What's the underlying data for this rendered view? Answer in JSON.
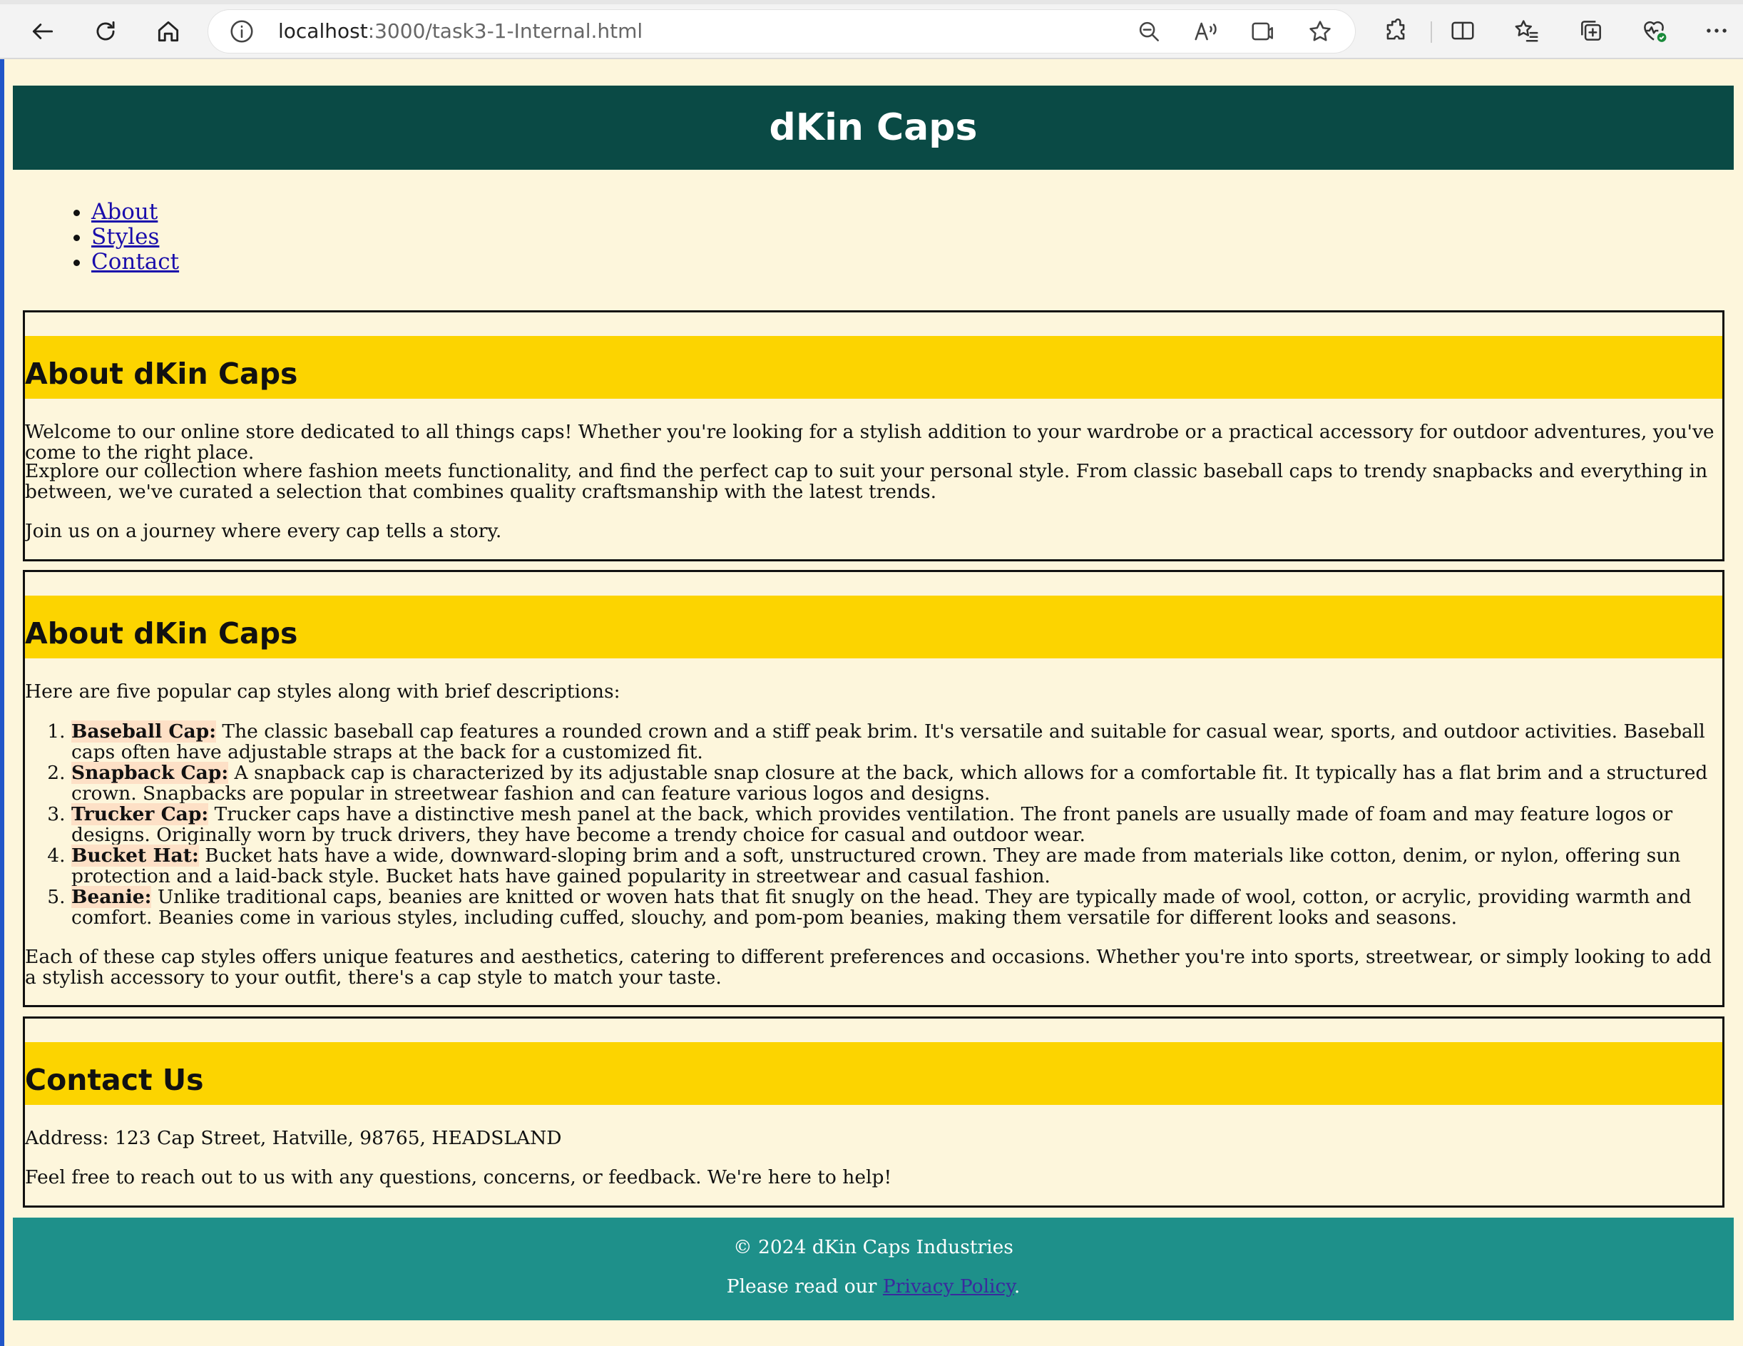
{
  "browser": {
    "url_host": "localhost",
    "url_path": ":3000/task3-1-Internal.html"
  },
  "header": {
    "title": "dKin Caps"
  },
  "nav": {
    "items": [
      "About",
      "Styles",
      "Contact"
    ]
  },
  "about": {
    "heading": "About dKin Caps",
    "p1": "Welcome to our online store dedicated to all things caps! Whether you're looking for a stylish addition to your wardrobe or a practical accessory for outdoor adventures, you've come to the right place.",
    "p2": "Explore our collection where fashion meets functionality, and find the perfect cap to suit your personal style. From classic baseball caps to trendy snapbacks and everything in between, we've curated a selection that combines quality craftsmanship with the latest trends.",
    "p3": "Join us on a journey where every cap tells a story."
  },
  "styles": {
    "heading": "About dKin Caps",
    "intro": "Here are five popular cap styles along with brief descriptions:",
    "items": [
      {
        "name": "Baseball Cap:",
        "desc": " The classic baseball cap features a rounded crown and a stiff peak brim. It's versatile and suitable for casual wear, sports, and outdoor activities. Baseball caps often have adjustable straps at the back for a customized fit."
      },
      {
        "name": "Snapback Cap:",
        "desc": " A snapback cap is characterized by its adjustable snap closure at the back, which allows for a comfortable fit. It typically has a flat brim and a structured crown. Snapbacks are popular in streetwear fashion and can feature various logos and designs."
      },
      {
        "name": "Trucker Cap:",
        "desc": " Trucker caps have a distinctive mesh panel at the back, which provides ventilation. The front panels are usually made of foam and may feature logos or designs. Originally worn by truck drivers, they have become a trendy choice for casual and outdoor wear."
      },
      {
        "name": "Bucket Hat:",
        "desc": " Bucket hats have a wide, downward-sloping brim and a soft, unstructured crown. They are made from materials like cotton, denim, or nylon, offering sun protection and a laid-back style. Bucket hats have gained popularity in streetwear and casual fashion."
      },
      {
        "name": "Beanie:",
        "desc": " Unlike traditional caps, beanies are knitted or woven hats that fit snugly on the head. They are typically made of wool, cotton, or acrylic, providing warmth and comfort. Beanies come in various styles, including cuffed, slouchy, and pom-pom beanies, making them versatile for different looks and seasons."
      }
    ],
    "outro": "Each of these cap styles offers unique features and aesthetics, catering to different preferences and occasions. Whether you're into sports, streetwear, or simply looking to add a stylish accessory to your outfit, there's a cap style to match your taste."
  },
  "contact": {
    "heading": "Contact Us",
    "address": "Address: 123 Cap Street, Hatville, 98765, HEADSLAND",
    "note": "Feel free to reach out to us with any questions, concerns, or feedback. We're here to help!"
  },
  "footer": {
    "copyright": "© 2024 dKin Caps Industries",
    "privacy_prefix": "Please read our ",
    "privacy_link": "Privacy Policy",
    "privacy_suffix": "."
  },
  "colors": {
    "page_bg": "#fdf6dc",
    "header_bg": "#0a4a45",
    "section_bar": "#fcd400",
    "footer_bg": "#1e908a",
    "highlight": "#fde0c6"
  }
}
